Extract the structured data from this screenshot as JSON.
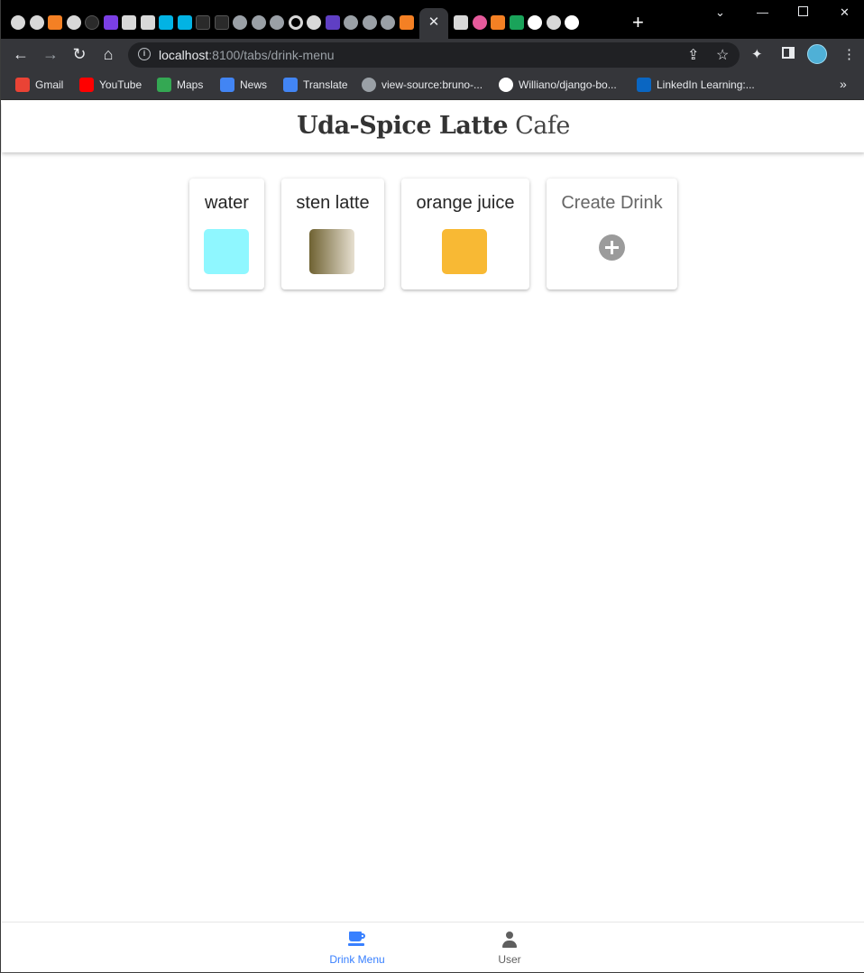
{
  "browser": {
    "address_host": "localhost",
    "address_path": ":8100/tabs/drink-menu",
    "bookmarks": [
      {
        "label": "Gmail",
        "icon": "gmail-icon",
        "color": "#ea4335"
      },
      {
        "label": "YouTube",
        "icon": "youtube-icon",
        "color": "#ff0000"
      },
      {
        "label": "Maps",
        "icon": "maps-icon",
        "color": "#34a853"
      },
      {
        "label": "News",
        "icon": "news-icon",
        "color": "#4285f4"
      },
      {
        "label": "Translate",
        "icon": "translate-icon",
        "color": "#4285f4"
      },
      {
        "label": "view-source:bruno-...",
        "icon": "globe-icon",
        "color": "#9aa0a6"
      },
      {
        "label": "Williano/django-bo...",
        "icon": "github-icon",
        "color": "#ffffff"
      },
      {
        "label": "LinkedIn Learning:...",
        "icon": "linkedin-learning-icon",
        "color": "#0a66c2"
      }
    ]
  },
  "app": {
    "title_bold": "Uda-Spice Latte",
    "title_light": "Cafe"
  },
  "drinks": [
    {
      "name": "water",
      "color": "#8ff7ff"
    },
    {
      "name": "sten latte",
      "color_from": "#6f6232",
      "color_to": "#e6dfd0"
    },
    {
      "name": "orange juice",
      "color": "#f8b934"
    }
  ],
  "create_card": {
    "label": "Create Drink"
  },
  "tabbar": {
    "drink_menu": "Drink Menu",
    "user": "User",
    "active_color": "#3880ff",
    "inactive_color": "#5f5f5f"
  }
}
